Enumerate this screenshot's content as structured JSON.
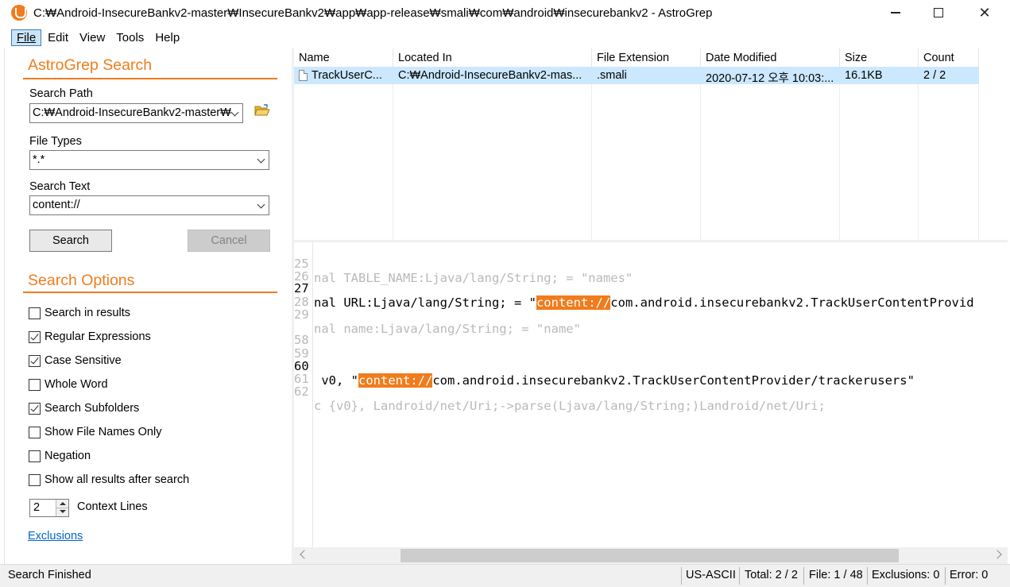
{
  "window": {
    "title": "C:₩Android-InsecureBankv2-master₩InsecureBankv2₩app₩app-release₩smali₩com₩android₩insecurebankv2 - AstroGrep",
    "minimize_icon": "minimize-icon",
    "maximize_icon": "maximize-icon",
    "close_icon": "close-icon"
  },
  "menu": {
    "file": "File",
    "edit": "Edit",
    "view": "View",
    "tools": "Tools",
    "help": "Help"
  },
  "search_panel": {
    "heading": "AstroGrep Search",
    "search_path_label": "Search Path",
    "search_path_value": "C:₩Android-InsecureBankv2-master₩",
    "file_types_label": "File Types",
    "file_types_value": "*.*",
    "search_text_label": "Search Text",
    "search_text_value": "content://",
    "search_button": "Search",
    "cancel_button": "Cancel"
  },
  "options": {
    "heading": "Search Options",
    "items": [
      {
        "label": "Search in results",
        "checked": false
      },
      {
        "label": "Regular Expressions",
        "checked": true
      },
      {
        "label": "Case Sensitive",
        "checked": true
      },
      {
        "label": "Whole Word",
        "checked": false
      },
      {
        "label": "Search Subfolders",
        "checked": true
      },
      {
        "label": "Show File Names Only",
        "checked": false
      },
      {
        "label": "Negation",
        "checked": false
      },
      {
        "label": "Show all results after search",
        "checked": false
      }
    ],
    "context_lines_value": "2",
    "context_lines_label": "Context Lines",
    "exclusions_link": "Exclusions"
  },
  "results": {
    "columns": [
      "Name",
      "Located In",
      "File Extension",
      "Date Modified",
      "Size",
      "Count"
    ],
    "rows": [
      {
        "name": "TrackUserC...",
        "located_in": "C:₩Android-InsecureBankv2-mas...",
        "extension": ".smali",
        "date_modified": "2020-07-12 오후 10:03:...",
        "size": "16.1KB",
        "count": "2 / 2"
      }
    ]
  },
  "preview": {
    "lines": [
      {
        "num": "25",
        "pre": "nal TABLE_NAME:Ljava/lang/String; = \"names\"",
        "match": "",
        "post": "",
        "dim": true
      },
      {
        "num": "26",
        "pre": "",
        "match": "",
        "post": "",
        "dim": true
      },
      {
        "num": "27",
        "pre": "nal URL:Ljava/lang/String; = \"",
        "match": "content://",
        "post": "com.android.insecurebankv2.TrackUserContentProvid",
        "dim": false
      },
      {
        "num": "28",
        "pre": "",
        "match": "",
        "post": "",
        "dim": true
      },
      {
        "num": "29",
        "pre": "nal name:Ljava/lang/String; = \"name\"",
        "match": "",
        "post": "",
        "dim": true
      },
      {
        "num": "58",
        "pre": "",
        "match": "",
        "post": "",
        "dim": true
      },
      {
        "num": "59",
        "pre": "",
        "match": "",
        "post": "",
        "dim": true
      },
      {
        "num": "60",
        "pre": " v0, \"",
        "match": "content://",
        "post": "com.android.insecurebankv2.TrackUserContentProvider/trackerusers\"",
        "dim": false
      },
      {
        "num": "61",
        "pre": "",
        "match": "",
        "post": "",
        "dim": true
      },
      {
        "num": "62",
        "pre": "c {v0}, Landroid/net/Uri;->parse(Ljava/lang/String;)Landroid/net/Uri;",
        "match": "",
        "post": "",
        "dim": true
      }
    ]
  },
  "status": {
    "message": "Search Finished",
    "encoding": "US-ASCII",
    "total": "Total: 2 / 2",
    "file": "File: 1 / 48",
    "exclusions": "Exclusions: 0",
    "error": "Error: 0"
  },
  "colors": {
    "accent": "#f07c1c",
    "selection": "#cce8ff",
    "link": "#0066cc"
  }
}
